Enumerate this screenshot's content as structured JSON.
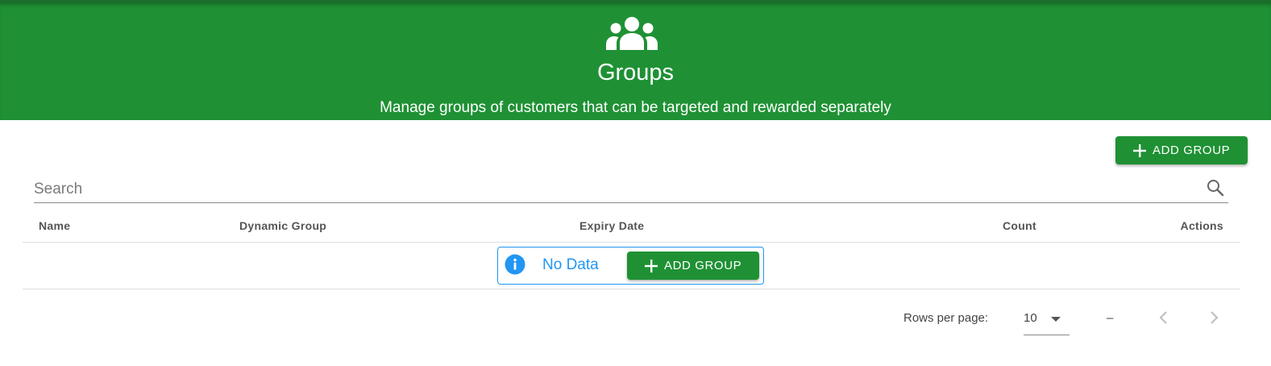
{
  "header": {
    "icon": "groups-icon",
    "title": "Groups",
    "subtitle": "Manage groups of customers that can be targeted and rewarded separately"
  },
  "toolbar": {
    "add_group_label": "ADD GROUP"
  },
  "search": {
    "placeholder": "Search",
    "value": ""
  },
  "table": {
    "columns": [
      "Name",
      "Dynamic Group",
      "Expiry Date",
      "Count",
      "Actions"
    ],
    "rows": [],
    "empty": {
      "message": "No Data",
      "add_label": "ADD GROUP"
    }
  },
  "pagination": {
    "rows_per_page_label": "Rows per page:",
    "rows_per_page": "10",
    "range": "–"
  },
  "colors": {
    "brand_green": "#1f9134",
    "info_blue": "#2196f3"
  }
}
